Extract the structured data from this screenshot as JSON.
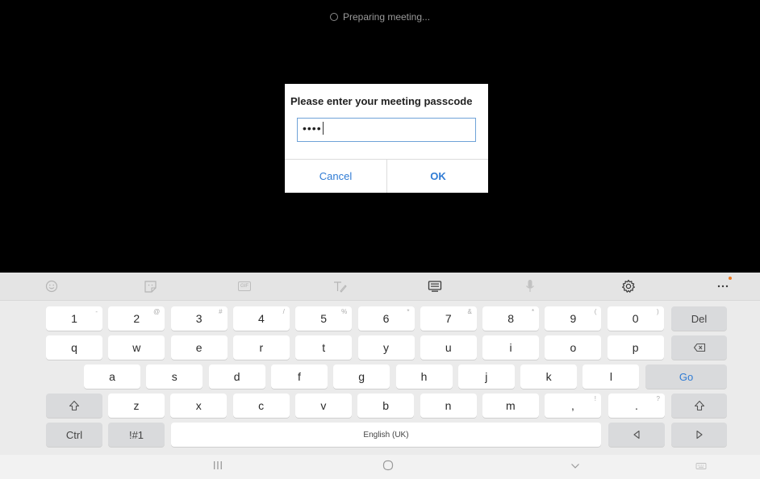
{
  "status": {
    "text": "Preparing meeting..."
  },
  "dialog": {
    "title": "Please enter your meeting passcode",
    "passcode_value": "••••",
    "cancel_label": "Cancel",
    "ok_label": "OK"
  },
  "toolbar": {
    "icons": [
      "emoji-icon",
      "sticker-icon",
      "gif-icon",
      "handwriting-icon",
      "keyboard-mode-icon",
      "microphone-icon",
      "settings-icon",
      "more-icon"
    ],
    "gif_label": "GIF"
  },
  "keyboard": {
    "row1": [
      {
        "k": "1",
        "s": "-"
      },
      {
        "k": "2",
        "s": "@"
      },
      {
        "k": "3",
        "s": "#"
      },
      {
        "k": "4",
        "s": "/"
      },
      {
        "k": "5",
        "s": "%"
      },
      {
        "k": "6",
        "s": "*"
      },
      {
        "k": "7",
        "s": "&"
      },
      {
        "k": "8",
        "s": "*"
      },
      {
        "k": "9",
        "s": "("
      },
      {
        "k": "0",
        "s": ")"
      }
    ],
    "del_label": "Del",
    "row2": [
      "q",
      "w",
      "e",
      "r",
      "t",
      "y",
      "u",
      "i",
      "o",
      "p"
    ],
    "row3": [
      "a",
      "s",
      "d",
      "f",
      "g",
      "h",
      "j",
      "k",
      "l"
    ],
    "go_label": "Go",
    "row4": [
      "z",
      "x",
      "c",
      "v",
      "b",
      "n",
      "m"
    ],
    "comma_key": {
      "k": ",",
      "s": "!"
    },
    "period_key": {
      "k": ".",
      "s": "?"
    },
    "ctrl_label": "Ctrl",
    "symbols_label": "!#1",
    "space_label": "English (UK)"
  },
  "colors": {
    "accent": "#2f7bd4",
    "notification_dot": "#f07a20"
  }
}
